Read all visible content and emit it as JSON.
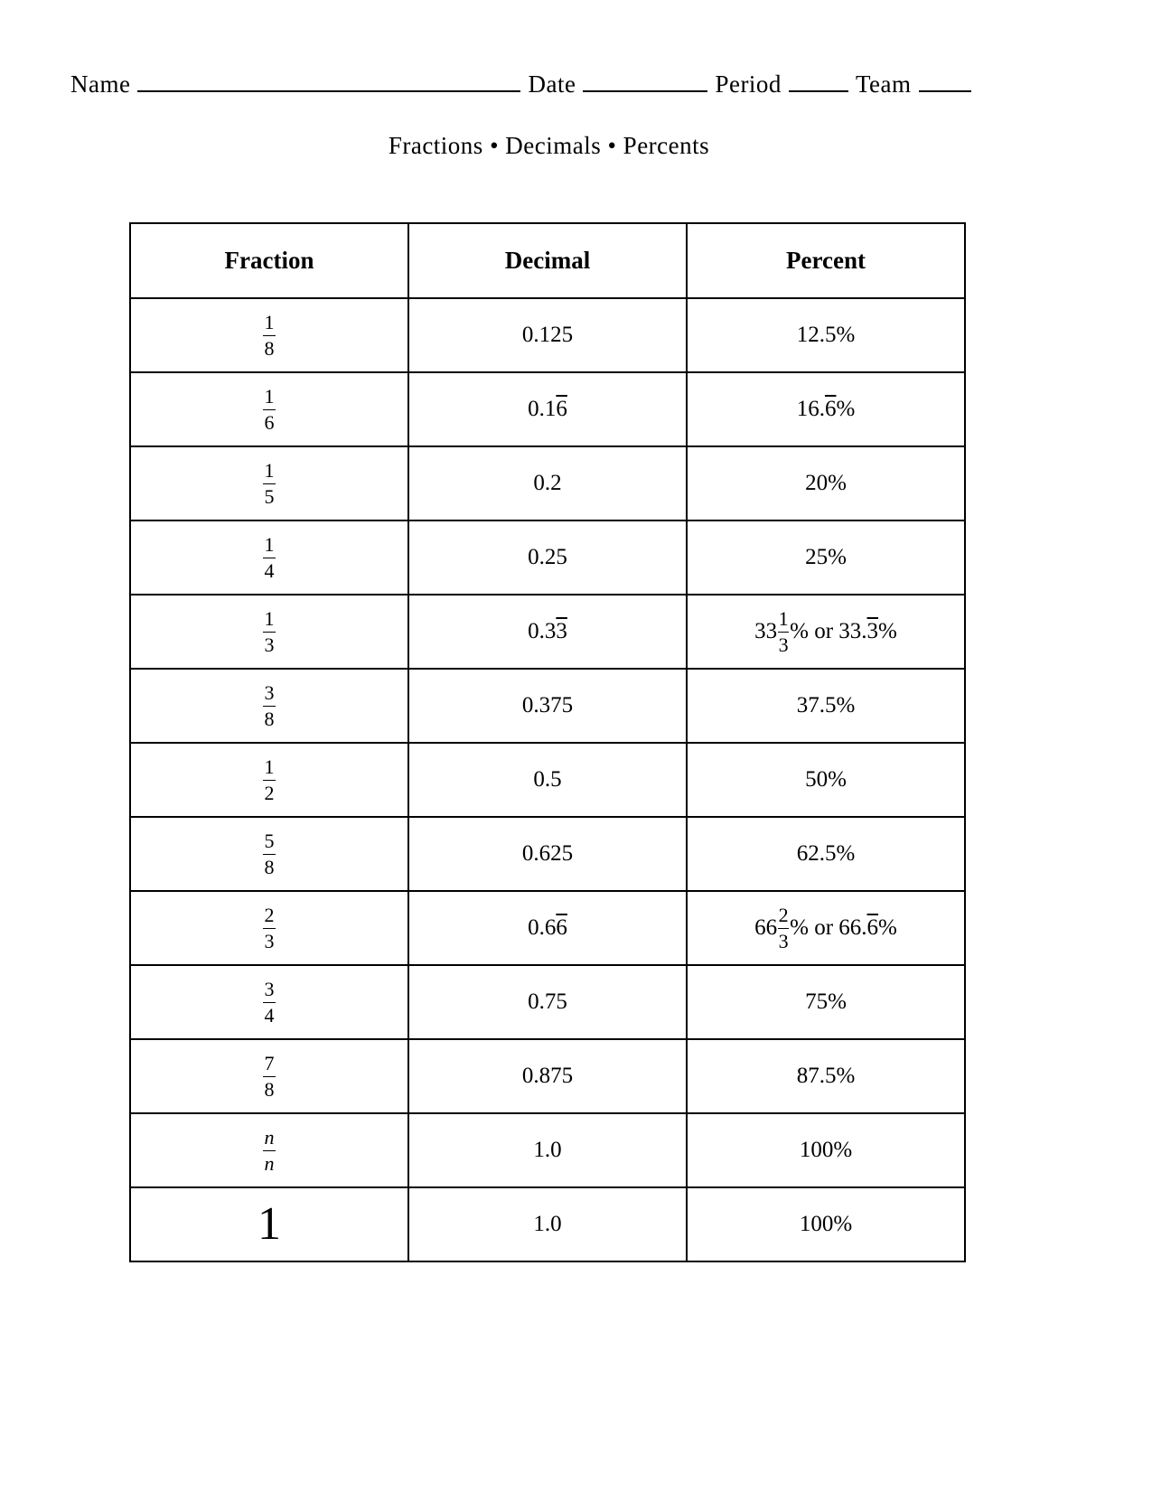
{
  "header": {
    "name_label": "Name",
    "date_label": "Date",
    "period_label": "Period",
    "team_label": "Team"
  },
  "title": "Fractions • Decimals • Percents",
  "table": {
    "columns": [
      "Fraction",
      "Decimal",
      "Percent"
    ],
    "rows": [
      {
        "fraction": {
          "num": "1",
          "den": "8"
        },
        "decimal": {
          "lead": "0.125",
          "repeat": ""
        },
        "percent": {
          "lead": "12.5",
          "repeat": "",
          "tail": "%"
        }
      },
      {
        "fraction": {
          "num": "1",
          "den": "6"
        },
        "decimal": {
          "lead": "0.1",
          "repeat": "6"
        },
        "percent": {
          "lead": "16.",
          "repeat": "6",
          "tail": "%"
        }
      },
      {
        "fraction": {
          "num": "1",
          "den": "5"
        },
        "decimal": {
          "lead": "0.2",
          "repeat": ""
        },
        "percent": {
          "lead": "20",
          "repeat": "",
          "tail": "%"
        }
      },
      {
        "fraction": {
          "num": "1",
          "den": "4"
        },
        "decimal": {
          "lead": "0.25",
          "repeat": ""
        },
        "percent": {
          "lead": "25",
          "repeat": "",
          "tail": "%"
        }
      },
      {
        "fraction": {
          "num": "1",
          "den": "3"
        },
        "decimal": {
          "lead": "0.3",
          "repeat": "3"
        },
        "percent_mixed": {
          "whole": "33",
          "num": "1",
          "den": "3",
          "after": "% or 33.",
          "repeat": "3",
          "tail": "%"
        }
      },
      {
        "fraction": {
          "num": "3",
          "den": "8"
        },
        "decimal": {
          "lead": "0.375",
          "repeat": ""
        },
        "percent": {
          "lead": "37.5",
          "repeat": "",
          "tail": "%"
        }
      },
      {
        "fraction": {
          "num": "1",
          "den": "2"
        },
        "decimal": {
          "lead": "0.5",
          "repeat": ""
        },
        "percent": {
          "lead": "50",
          "repeat": "",
          "tail": "%"
        }
      },
      {
        "fraction": {
          "num": "5",
          "den": "8"
        },
        "decimal": {
          "lead": "0.625",
          "repeat": ""
        },
        "percent": {
          "lead": "62.5",
          "repeat": "",
          "tail": "%"
        }
      },
      {
        "fraction": {
          "num": "2",
          "den": "3"
        },
        "decimal": {
          "lead": "0.6",
          "repeat": "6"
        },
        "percent_mixed": {
          "whole": "66",
          "num": "2",
          "den": "3",
          "after": "% or 66.",
          "repeat": "6",
          "tail": "%"
        }
      },
      {
        "fraction": {
          "num": "3",
          "den": "4"
        },
        "decimal": {
          "lead": "0.75",
          "repeat": ""
        },
        "percent": {
          "lead": "75",
          "repeat": "",
          "tail": "%"
        }
      },
      {
        "fraction": {
          "num": "7",
          "den": "8"
        },
        "decimal": {
          "lead": "0.875",
          "repeat": ""
        },
        "percent": {
          "lead": "87.5",
          "repeat": "",
          "tail": "%"
        }
      },
      {
        "fraction": {
          "num": "n",
          "den": "n",
          "italic": true
        },
        "decimal": {
          "lead": "1.0",
          "repeat": ""
        },
        "percent": {
          "lead": "100",
          "repeat": "",
          "tail": "%"
        }
      },
      {
        "fraction_whole": "1",
        "decimal": {
          "lead": "1.0",
          "repeat": ""
        },
        "percent": {
          "lead": "100",
          "repeat": "",
          "tail": "%"
        }
      }
    ]
  }
}
